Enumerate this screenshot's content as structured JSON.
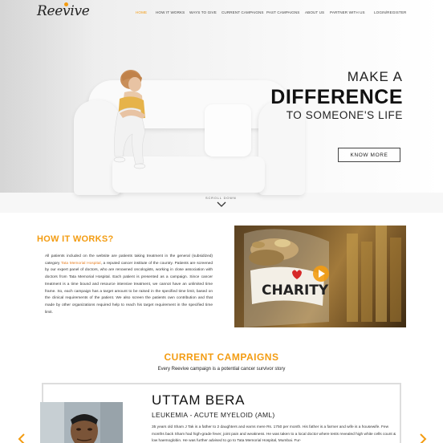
{
  "header": {
    "logo_text": "Reevive",
    "nav": [
      {
        "label": "HOME",
        "active": true
      },
      {
        "label": "HOW IT WORKS",
        "active": false
      },
      {
        "label": "WAYS TO GIVE",
        "active": false
      },
      {
        "label": "CURRENT CAMPAIGNS",
        "active": false
      },
      {
        "label": "PAST CAMPAIGNS",
        "active": false
      },
      {
        "label": "ABOUT US",
        "active": false
      },
      {
        "label": "PARTNER WITH US",
        "active": false
      },
      {
        "label": "LOGIN/REGISTER",
        "active": false
      }
    ]
  },
  "hero": {
    "line1": "MAKE A",
    "line2": "DIFFERENCE",
    "line3": "TO SOMEONE'S LIFE",
    "cta": "KNOW MORE",
    "scroll_label": "SCROLL DOWN"
  },
  "how_it_works": {
    "title": "HOW IT WORKS?",
    "text_before": "All patients included on the website are patients taking treatment in the general (subsidized) category ",
    "highlight": "Tata Memorial Hospital",
    "text_after": ", a reputed cancer institute of the country. Patients are screened by our expert panel of doctors, who are renowned oncologists, working in close association with doctors from Tata Memorial Hospital. Each patient is presented as a campaign. Since cancer treatment is a time bound and resource intensive treatment, we cannot have an unlimited time frame. So, each campaign has a target amount to be raised in the specified time limit, based on the clinical requirements of the patient. We also screen the patients own contribution and that made by other organizations required help to reach his target requirement in the specified time limit.",
    "image_text": "CHARITY"
  },
  "campaigns": {
    "title": "CURRENT CAMPAIGNS",
    "subtitle": "Every Reevive campaign is a potential cancer survivor story",
    "featured": {
      "name": "UTTAM BERA",
      "disease": "LEUKEMIA - ACUTE MYELOID (AML)",
      "description": "35 years old Sham J Tak is a father to 2 daughters and earns mere Rs. 1750 per month. His father is a farmer and wife is a housewife. Few months back Sham had high-grade fever, joint pain and weakness. He was taken to a local doctor where tests revealed high white cells count & low haemoglobin. He was further advised to go to Tata Memorial Hospital, Mumbai. Fur-"
    }
  },
  "colors": {
    "accent": "#f39c12",
    "text": "#333333"
  }
}
